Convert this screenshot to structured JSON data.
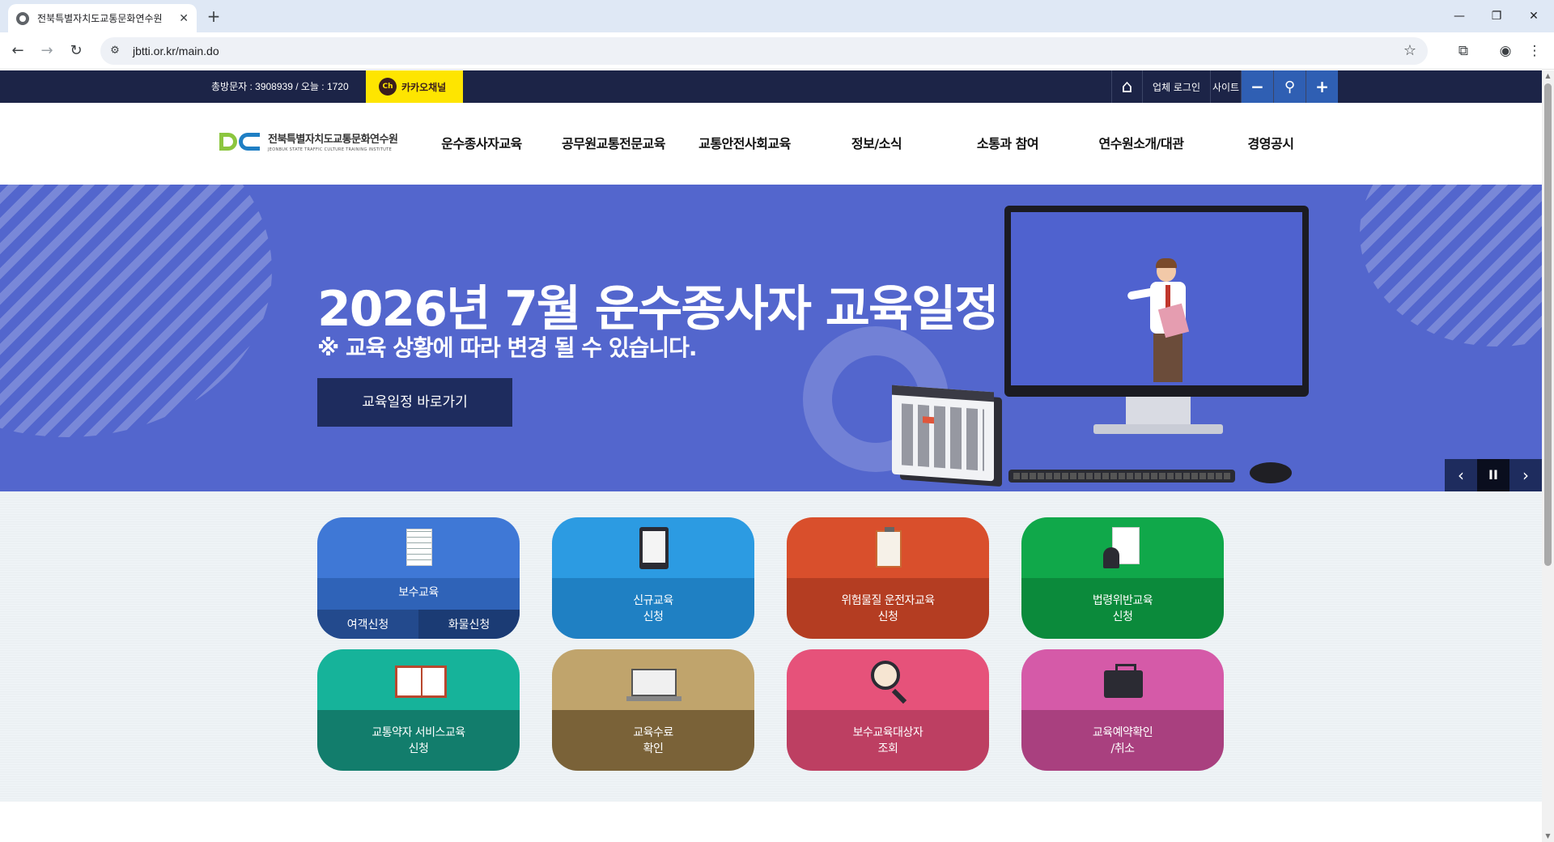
{
  "browser": {
    "tab_title": "전북특별자치도교통문화연수원",
    "tab_close": "✕",
    "new_tab": "+",
    "url": "jbtti.or.kr/main.do",
    "icons": [
      "back-icon",
      "forward-icon",
      "reload-icon",
      "site-info-icon",
      "bookmark-star-icon",
      "extensions-icon",
      "profile-icon",
      "menu-icon"
    ],
    "window_controls": {
      "minimize": "—",
      "restore": "❐",
      "close": "✕"
    }
  },
  "topbar": {
    "visitor_text": "총방문자 : 3908939 / 오늘 : 1720",
    "kakao_badge": "Ch",
    "kakao_label": "카카오채널",
    "home_icon": "⌂",
    "biz_login": "업체 로그인",
    "sitemap": "사이트",
    "zoom_out": "−",
    "zoom_reset": "⚲",
    "zoom_in": "+"
  },
  "header": {
    "logo_ko": "전북특별자치도교통문화연수원",
    "logo_en": "JEONBUK STATE TRAFFIC CULTURE TRAINING INSTITUTE",
    "nav": [
      "운수종사자교육",
      "공무원교통전문교육",
      "교통안전사회교육",
      "정보/소식",
      "소통과 참여",
      "연수원소개/대관",
      "경영공시"
    ]
  },
  "hero": {
    "title": "2026년 7월 운수종사자 교육일정",
    "subtitle": "※ 교육 상황에 따라 변경 될 수 있습니다.",
    "button": "교육일정 바로가기",
    "prev": "‹",
    "pause": "II",
    "next": "›",
    "bg_color": "#5366cd"
  },
  "quick": {
    "cards": [
      {
        "label": "보수교육",
        "sub_left": "여객신청",
        "sub_right": "화물신청",
        "icon": "document-pen-icon",
        "top": "#3f78d6",
        "bottom": "#2f63b8",
        "left_bg": "#234a8d",
        "right_bg": "#1b3b74"
      },
      {
        "label": "신규교육\n신청",
        "icon": "tablet-icon",
        "top": "#2c9be2",
        "bottom": "#1f80c3"
      },
      {
        "label": "위험물질 운전자교육\n신청",
        "icon": "clipboard-icon",
        "top": "#d94f2c",
        "bottom": "#b43d22"
      },
      {
        "label": "법령위반교육\n신청",
        "icon": "person-document-icon",
        "top": "#10a84a",
        "bottom": "#0b8a3b"
      },
      {
        "label": "교통약자 서비스교육\n신청",
        "icon": "open-book-icon",
        "top": "#16b39a",
        "bottom": "#127d6c"
      },
      {
        "label": "교육수료\n확인",
        "icon": "laptop-certificate-icon",
        "top": "#c0a46c",
        "bottom": "#7a6238"
      },
      {
        "label": "보수교육대상자\n조회",
        "icon": "magnifier-person-icon",
        "top": "#e6527a",
        "bottom": "#bd3f62"
      },
      {
        "label": "교육예약확인\n/취소",
        "icon": "briefcase-icon",
        "top": "#d55aa8",
        "bottom": "#a9407f"
      }
    ]
  }
}
